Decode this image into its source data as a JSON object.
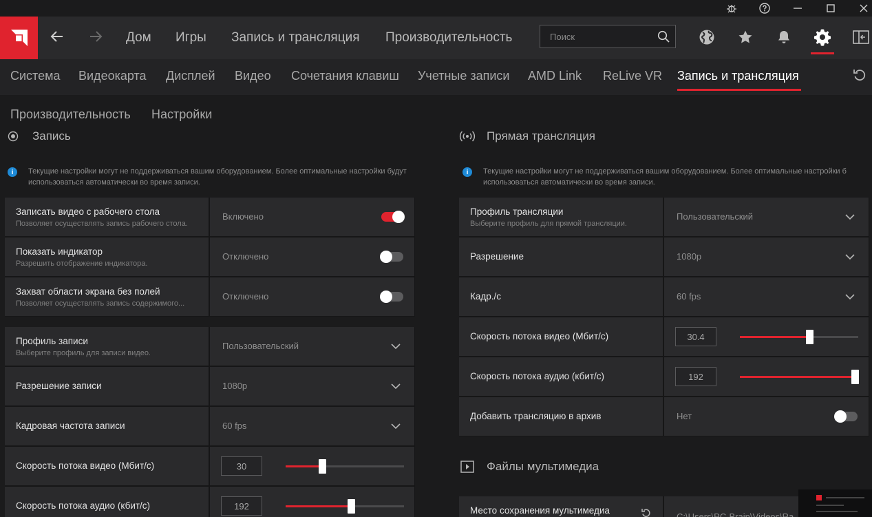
{
  "titlebar": {
    "icons": [
      "bug-icon",
      "help-icon",
      "minimize-icon",
      "maximize-icon",
      "close-icon"
    ]
  },
  "topnav": {
    "logo": "amd-logo",
    "links": [
      "Дом",
      "Игры",
      "Запись и трансляция",
      "Производительность"
    ],
    "search_placeholder": "Поиск",
    "icons": [
      "globe-icon",
      "star-icon",
      "bell-icon",
      "gear-icon",
      "sidebar-toggle-icon"
    ]
  },
  "tabs": {
    "items": [
      "Система",
      "Видеокарта",
      "Дисплей",
      "Видео",
      "Сочетания клавиш",
      "Учетные записи",
      "AMD Link",
      "ReLive VR",
      "Запись и трансляция"
    ],
    "active_index": 8
  },
  "subtabs": [
    "Производительность",
    "Настройки"
  ],
  "colors": {
    "accent": "#e0232e",
    "info": "#1e8ad6",
    "panel": "#2a2a2c",
    "background": "#1b1b1c"
  },
  "recording": {
    "header": "Запись",
    "info_line1": "Текущие настройки могут не поддерживаться вашим оборудованием. Более оптимальные настройки будут",
    "info_line2": "использоваться автоматически во время записи.",
    "rows": [
      {
        "title": "Записать видео с рабочего стола",
        "desc": "Позволяет осуществлять запись рабочего стола.",
        "value": "Включено",
        "toggle": true
      },
      {
        "title": "Показать индикатор",
        "desc": "Разрешить отображение индикатора.",
        "value": "Отключено",
        "toggle": false
      },
      {
        "title": "Захват области экрана без полей",
        "desc": "Позволяет осуществлять запись содержимого...",
        "value": "Отключено",
        "toggle": false
      }
    ],
    "rows2": [
      {
        "title": "Профиль записи",
        "desc": "Выберите профиль для записи видео.",
        "value": "Пользовательский"
      },
      {
        "title": "Разрешение записи",
        "value": "1080p"
      },
      {
        "title": "Кадровая частота записи",
        "value": "60 fps"
      }
    ],
    "video_bitrate": {
      "title": "Скорость потока видео (Мбит/с)",
      "value": "30",
      "level": 0.31
    },
    "audio_bitrate": {
      "title": "Скорость потока аудио (кбит/с)",
      "value": "192",
      "level": 0.55
    }
  },
  "streaming": {
    "header": "Прямая трансляция",
    "info_line1": "Текущие настройки могут не поддерживаться вашим оборудованием. Более оптимальные настройки б",
    "info_line2": "использоваться автоматически во время записи.",
    "rows": [
      {
        "title": "Профиль трансляции",
        "desc": "Выберите профиль для прямой трансляции.",
        "value": "Пользовательский"
      },
      {
        "title": "Разрешение",
        "value": "1080p"
      },
      {
        "title": "Кадр./с",
        "value": "60 fps"
      }
    ],
    "video_bitrate": {
      "title": "Скорость потока видео (Мбит/с)",
      "value": "30.4",
      "level": 0.59
    },
    "audio_bitrate": {
      "title": "Скорость потока аудио (кбит/с)",
      "value": "192",
      "level": 0.97
    },
    "archive": {
      "title": "Добавить трансляцию в архив",
      "value": "Нет",
      "toggle": false
    }
  },
  "media": {
    "header": "Файлы мультимедиа",
    "location_title": "Место сохранения мультимедиа",
    "location_value": "C:\\Users\\PC-Brain\\Videos\\Ra"
  }
}
